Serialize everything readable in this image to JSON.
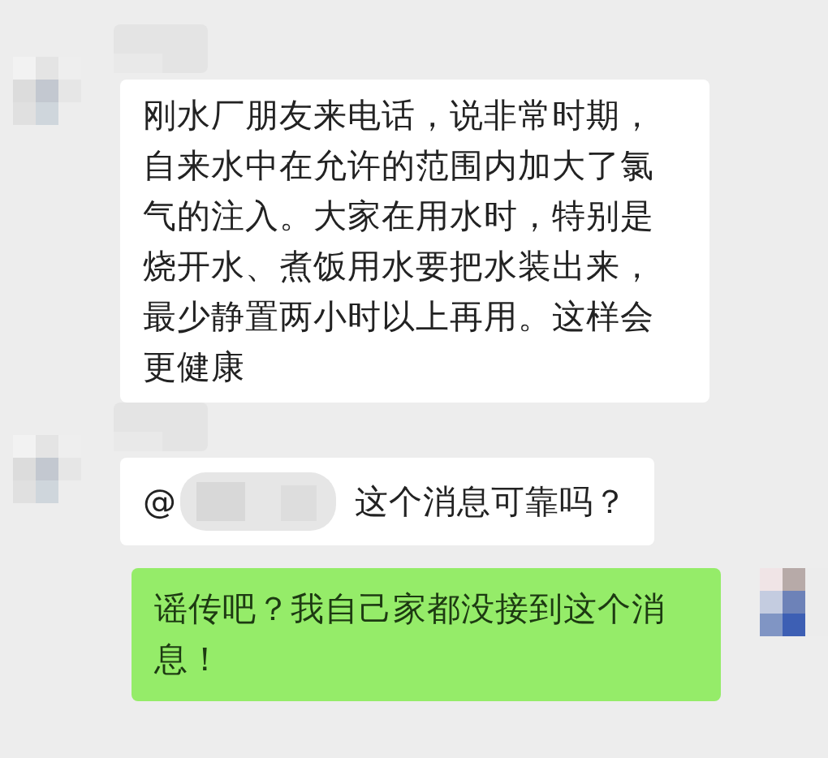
{
  "messages": [
    {
      "kind": "incoming",
      "text": "刚水厂朋友来电话，说非常时期，自来水中在允许的范围内加大了氯气的注入。大家在用水时，特别是烧开水、煮饭用水要把水装出来，最少静置两小时以上再用。这样会更健康"
    },
    {
      "kind": "incoming",
      "mention": "@",
      "text": "这个消息可靠吗？"
    },
    {
      "kind": "outgoing",
      "text": "谣传吧？我自己家都没接到这个消息！"
    }
  ]
}
